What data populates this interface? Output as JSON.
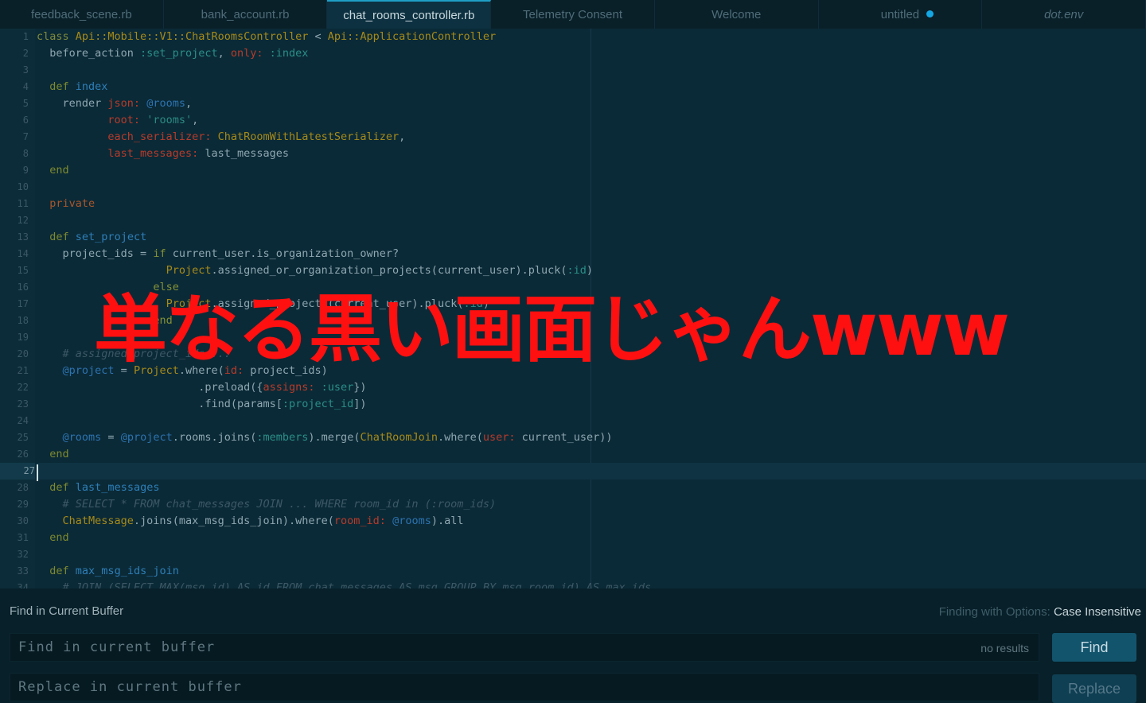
{
  "tabs": [
    {
      "label": "feedback_scene.rb"
    },
    {
      "label": "bank_account.rb"
    },
    {
      "label": "chat_rooms_controller.rb"
    },
    {
      "label": "Telemetry Consent"
    },
    {
      "label": "Welcome"
    },
    {
      "label": "untitled"
    },
    {
      "label": "dot.env"
    }
  ],
  "overlay_caption": "単なる黒い画面じゃんwww",
  "line_numbers": [
    "1",
    "2",
    "3",
    "4",
    "5",
    "6",
    "7",
    "8",
    "9",
    "10",
    "11",
    "12",
    "13",
    "14",
    "15",
    "16",
    "17",
    "18",
    "19",
    "20",
    "21",
    "22",
    "23",
    "24",
    "25",
    "26",
    "27",
    "28",
    "29",
    "30",
    "31",
    "32",
    "33",
    "34"
  ],
  "find_panel": {
    "title": "Find in Current Buffer",
    "options_prefix": "Finding with Options:",
    "options_value": "Case Insensitive",
    "find_placeholder": "Find in current buffer",
    "replace_placeholder": "Replace in current buffer",
    "results": "no results",
    "find_button": "Find",
    "replace_button": "Replace"
  },
  "colors": {
    "accent": "#1e9fc6",
    "overlay_text": "#ff1010",
    "modified_dot": "#14a7e3"
  }
}
